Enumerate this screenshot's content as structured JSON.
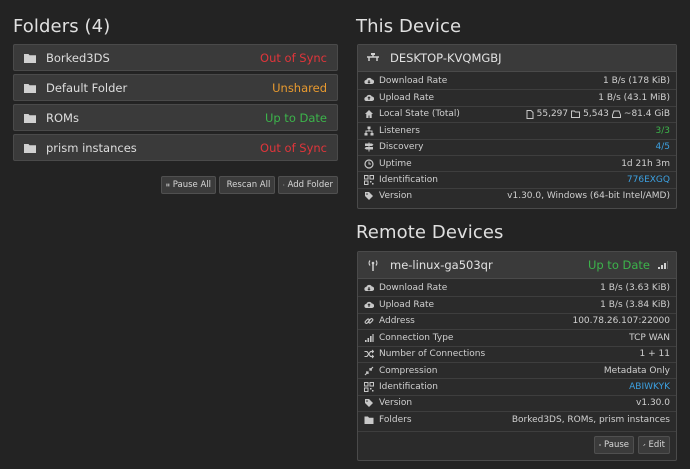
{
  "folders_section": {
    "title": "Folders (4)",
    "items": [
      {
        "name": "Borked3DS",
        "status": "Out of Sync",
        "status_color": "#e0353a"
      },
      {
        "name": "Default Folder",
        "status": "Unshared",
        "status_color": "#e89a2f"
      },
      {
        "name": "ROMs",
        "status": "Up to Date",
        "status_color": "#3cb44b"
      },
      {
        "name": "prism instances",
        "status": "Out of Sync",
        "status_color": "#e0353a"
      }
    ],
    "buttons": {
      "pause_all": "Pause All",
      "rescan_all": "Rescan All",
      "add_folder": "Add Folder"
    }
  },
  "this_device": {
    "title": "This Device",
    "name": "DESKTOP-KVQMGBJ",
    "rows": {
      "download_label": "Download Rate",
      "download_value": "1 B/s (178 KiB)",
      "upload_label": "Upload Rate",
      "upload_value": "1 B/s (43.1 MiB)",
      "local_state_label": "Local State (Total)",
      "files": "55,297",
      "dirs": "5,543",
      "size": "~81.4 GiB",
      "listeners_label": "Listeners",
      "listeners_value": "3/3",
      "discovery_label": "Discovery",
      "discovery_value": "4/5",
      "uptime_label": "Uptime",
      "uptime_value": "1d 21h 3m",
      "id_label": "Identification",
      "id_value": "776EXGQ",
      "version_label": "Version",
      "version_value": "v1.30.0, Windows (64-bit Intel/AMD)"
    }
  },
  "remote_devices": {
    "title": "Remote Devices",
    "device": {
      "name": "me-linux-ga503qr",
      "status": "Up to Date",
      "rows": {
        "download_label": "Download Rate",
        "download_value": "1 B/s (3.63 KiB)",
        "upload_label": "Upload Rate",
        "upload_value": "1 B/s (3.84 KiB)",
        "address_label": "Address",
        "address_value": "100.78.26.107:22000",
        "conn_type_label": "Connection Type",
        "conn_type_value": "TCP WAN",
        "num_conn_label": "Number of Connections",
        "num_conn_value": "1 + 11",
        "compression_label": "Compression",
        "compression_value": "Metadata Only",
        "id_label": "Identification",
        "id_value": "ABIWKYK",
        "version_label": "Version",
        "version_value": "v1.30.0",
        "folders_label": "Folders",
        "folders_value": "Borked3DS, ROMs, prism instances"
      },
      "buttons": {
        "pause": "Pause",
        "edit": "Edit"
      }
    }
  }
}
